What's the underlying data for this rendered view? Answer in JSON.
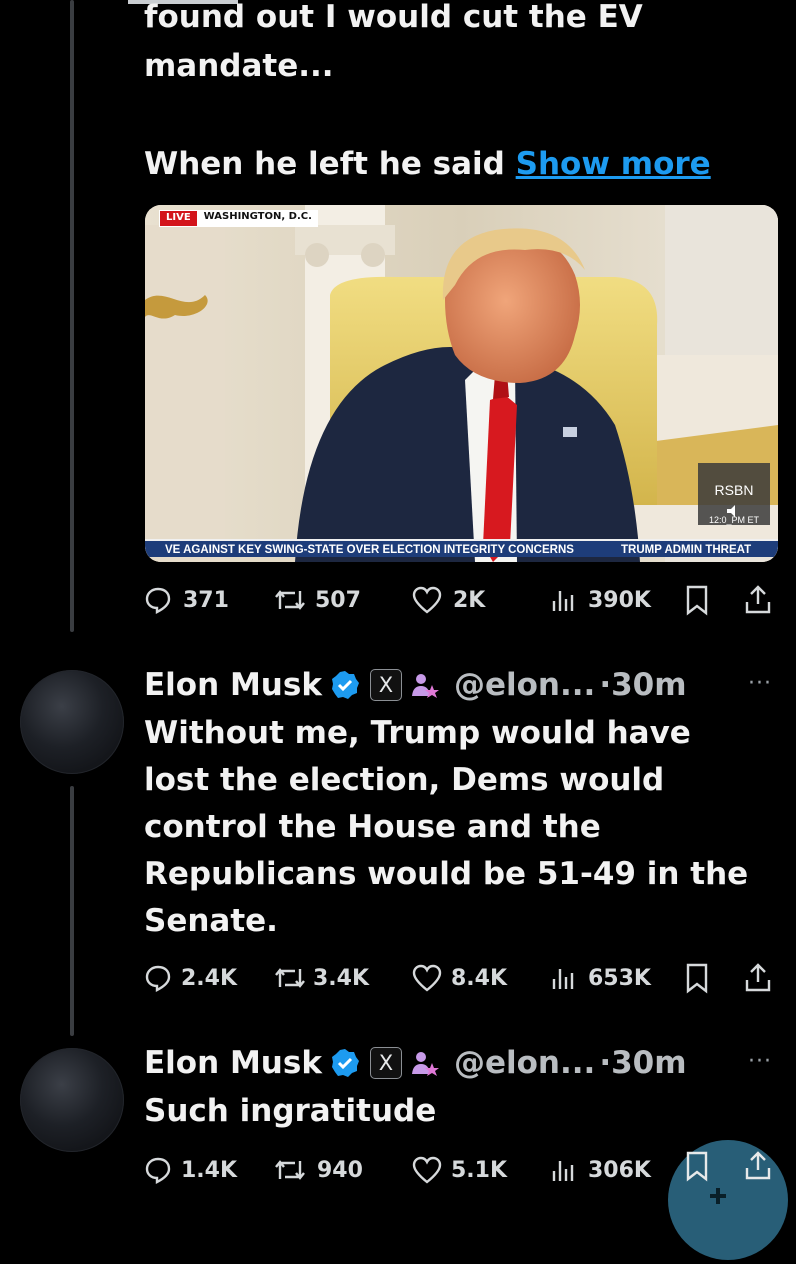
{
  "tweet1": {
    "text_line1": "found out I would cut the EV",
    "text_line2": "mandate...",
    "text_line3": "When he left he said",
    "show_more": "Show more",
    "media": {
      "live_label": "LIVE",
      "location": "WASHINGTON, D.C.",
      "ticker_left": "VE AGAINST KEY SWING-STATE OVER ELECTION INTEGRITY CONCERNS",
      "ticker_right": "TRUMP ADMIN THREAT",
      "network": "RSBN",
      "time": "12:0_PM ET"
    },
    "stats": {
      "replies": "371",
      "reposts": "507",
      "likes": "2K",
      "views": "390K"
    }
  },
  "tweet2": {
    "name": "Elon Musk",
    "x_badge": "X",
    "handle": "@elon...",
    "time": "·30m",
    "more": "···",
    "text_lines": [
      "Without me, Trump would have",
      "lost the election, Dems would",
      "control the House and the",
      "Republicans would be 51-49 in the",
      "Senate."
    ],
    "stats": {
      "replies": "2.4K",
      "reposts": "3.4K",
      "likes": "8.4K",
      "views": "653K"
    }
  },
  "tweet3": {
    "name": "Elon Musk",
    "x_badge": "X",
    "handle": "@elon...",
    "time": "·30m",
    "more": "···",
    "text": "Such ingratitude",
    "stats": {
      "replies": "1.4K",
      "reposts": "940",
      "likes": "5.1K",
      "views": "306K"
    }
  },
  "colors": {
    "background": "#000000",
    "link": "#1d9bf0",
    "verified": "#1d9bf0",
    "live_red": "#d3141b",
    "tie_red": "#d7191f"
  }
}
